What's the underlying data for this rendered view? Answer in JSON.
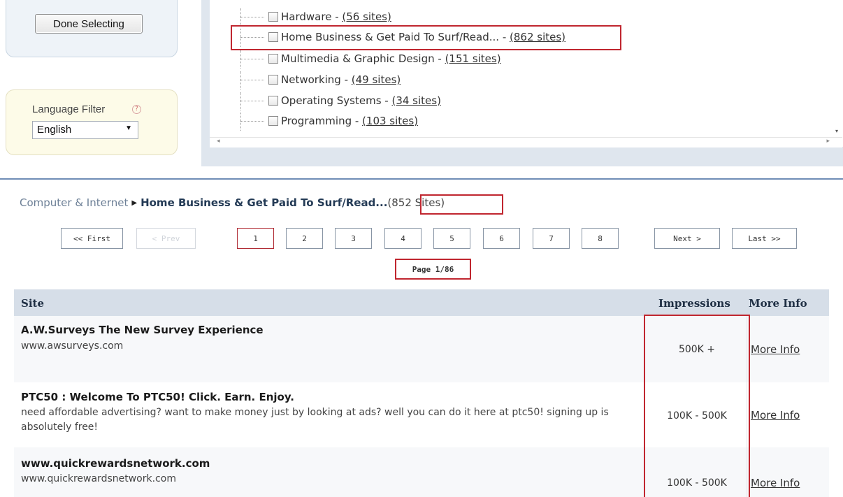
{
  "left_panel": {
    "done_button": "Done Selecting",
    "language_filter": {
      "label": "Language Filter",
      "help_glyph": "?",
      "selected": "English",
      "caret_glyph": "▼"
    }
  },
  "category_tree": {
    "items": [
      {
        "name": "Hardware - ",
        "count": "(56 sites)"
      },
      {
        "name": "Home Business & Get Paid To Surf/Read... - ",
        "count": "(862 sites)"
      },
      {
        "name": "Multimedia & Graphic Design - ",
        "count": "(151 sites)"
      },
      {
        "name": "Networking - ",
        "count": "(49 sites)"
      },
      {
        "name": "Operating Systems - ",
        "count": "(34 sites)"
      },
      {
        "name": "Programming - ",
        "count": "(103 sites)"
      }
    ],
    "scroll_left_glyph": "◂",
    "scroll_right_glyph": "▸",
    "scroll_down_glyph": "▾"
  },
  "breadcrumb": {
    "parent": "Computer & Internet",
    "arrow_glyph": "▶",
    "current": "Home Business & Get Paid To Surf/Read...",
    "count": "(852 Sites)"
  },
  "pagination": {
    "first": "<< First",
    "prev": "< Prev",
    "pages": [
      "1",
      "2",
      "3",
      "4",
      "5",
      "6",
      "7",
      "8"
    ],
    "next": "Next >",
    "last": "Last >>",
    "page_info": "Page 1/86"
  },
  "table": {
    "headers": {
      "site": "Site",
      "impressions": "Impressions",
      "more_info": "More Info"
    },
    "rows": [
      {
        "title": "A.W.Surveys The New Survey Experience",
        "description": "www.awsurveys.com",
        "impressions": "500K +",
        "more_info": "More Info"
      },
      {
        "title": "PTC50 : Welcome To PTC50! Click. Earn. Enjoy.",
        "description": "need affordable advertising? want to make money just by looking at ads? well you can do it here at ptc50! signing up is absolutely free!",
        "impressions": "100K - 500K",
        "more_info": "More Info"
      },
      {
        "title": "www.quickrewardsnetwork.com",
        "description": "www.quickrewardsnetwork.com",
        "impressions": "100K - 500K",
        "more_info": "More Info"
      }
    ]
  },
  "colors": {
    "highlight_border": "#c0262f",
    "table_header_bg": "#d6dee8",
    "divider": "#6f8db6"
  }
}
